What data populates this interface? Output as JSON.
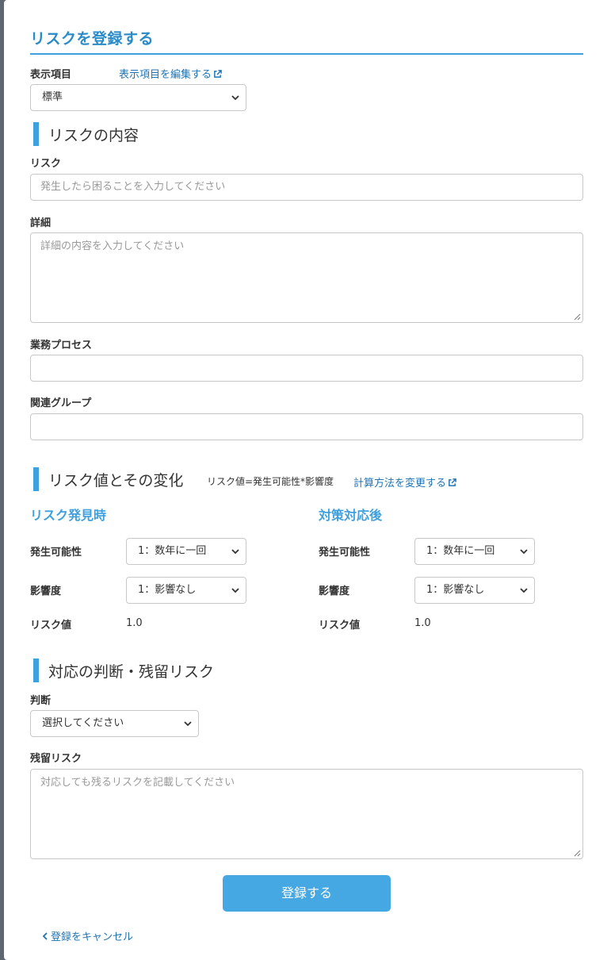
{
  "header": {
    "title": "リスクを登録する"
  },
  "display": {
    "label": "表示項目",
    "edit_link": "表示項目を編集する",
    "selected": "標準"
  },
  "risk_content": {
    "title": "リスクの内容",
    "risk_label": "リスク",
    "risk_placeholder": "発生したら困ることを入力してください",
    "detail_label": "詳細",
    "detail_placeholder": "詳細の内容を入力してください",
    "process_label": "業務プロセス",
    "group_label": "関連グループ"
  },
  "risk_value": {
    "title": "リスク値とその変化",
    "formula": "リスク値=発生可能性*影響度",
    "change_link": "計算方法を変更する",
    "before": {
      "title": "リスク発見時",
      "likelihood_label": "発生可能性",
      "likelihood_value": "1：数年に一回",
      "impact_label": "影響度",
      "impact_value": "1：影響なし",
      "risk_value_label": "リスク値",
      "risk_value": "1.0"
    },
    "after": {
      "title": "対策対応後",
      "likelihood_label": "発生可能性",
      "likelihood_value": "1：数年に一回",
      "impact_label": "影響度",
      "impact_value": "1：影響なし",
      "risk_value_label": "リスク値",
      "risk_value": "1.0"
    }
  },
  "judgement": {
    "title": "対応の判断・残留リスク",
    "judgement_label": "判断",
    "judgement_value": "選択してください",
    "residual_label": "残留リスク",
    "residual_placeholder": "対応しても残るリスクを記載してください"
  },
  "actions": {
    "submit": "登録する",
    "cancel": "登録をキャンセル"
  },
  "colors": {
    "accent": "#3ea0dd",
    "link": "#1f74b3",
    "button": "#46a8e2"
  }
}
